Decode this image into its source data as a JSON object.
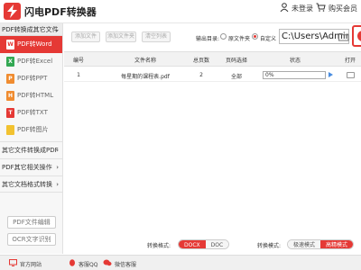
{
  "app": {
    "title": "闪电PDF转换器",
    "brand_color": "#e53935"
  },
  "titlebar": {
    "login_label": "未登录",
    "buy_label": "购买会员"
  },
  "sidebar": {
    "header": "PDF转换成其它文件",
    "items": [
      {
        "label": "PDF转Word",
        "badge": "W",
        "badge_color": "#e53935",
        "active": true
      },
      {
        "label": "PDF转Excel",
        "badge": "X",
        "badge_color": "#33a853"
      },
      {
        "label": "PDF转PPT",
        "badge": "P",
        "badge_color": "#f08c30"
      },
      {
        "label": "PDF转HTML",
        "badge": "H",
        "badge_color": "#f08c30"
      },
      {
        "label": "PDF转TXT",
        "badge": "T",
        "badge_color": "#e53935"
      },
      {
        "label": "PDF转图片",
        "badge": "",
        "badge_color": "#f2c230"
      }
    ],
    "groups": [
      {
        "label": "其它文件转换成PDF"
      },
      {
        "label": "PDF其它相关操作"
      },
      {
        "label": "其它文档格式转换"
      }
    ],
    "buttons": {
      "pdf_edit": "PDF文件编辑",
      "ocr": "OCR文字识别"
    }
  },
  "toolbar": {
    "add_file": "添加文件",
    "add_folder": "添加文件夹",
    "clear_list": "清空列表",
    "output_label": "输出目录:",
    "option_source": "原文件夹",
    "option_custom": "自定义",
    "selected_option": "custom",
    "path_value": "C:\\Users\\Admini"
  },
  "table": {
    "headers": [
      "编号",
      "文件名称",
      "总页数",
      "页码选择",
      "状态",
      "打开"
    ],
    "rows": [
      {
        "index": "1",
        "name": "每星期的课程表.pdf",
        "pages": "2",
        "range": "全部",
        "progress": "0%"
      }
    ]
  },
  "bottom": {
    "format_label": "转换格式:",
    "format_options": [
      "DOCX",
      "DOC"
    ],
    "format_selected": "DOCX",
    "mode_label": "转换模式:",
    "mode_options": [
      "极速模式",
      "高精模式"
    ],
    "mode_selected": "高精模式"
  },
  "statusbar": {
    "website": "官方网站",
    "qq": "客服QQ",
    "wechat": "微信客服"
  }
}
